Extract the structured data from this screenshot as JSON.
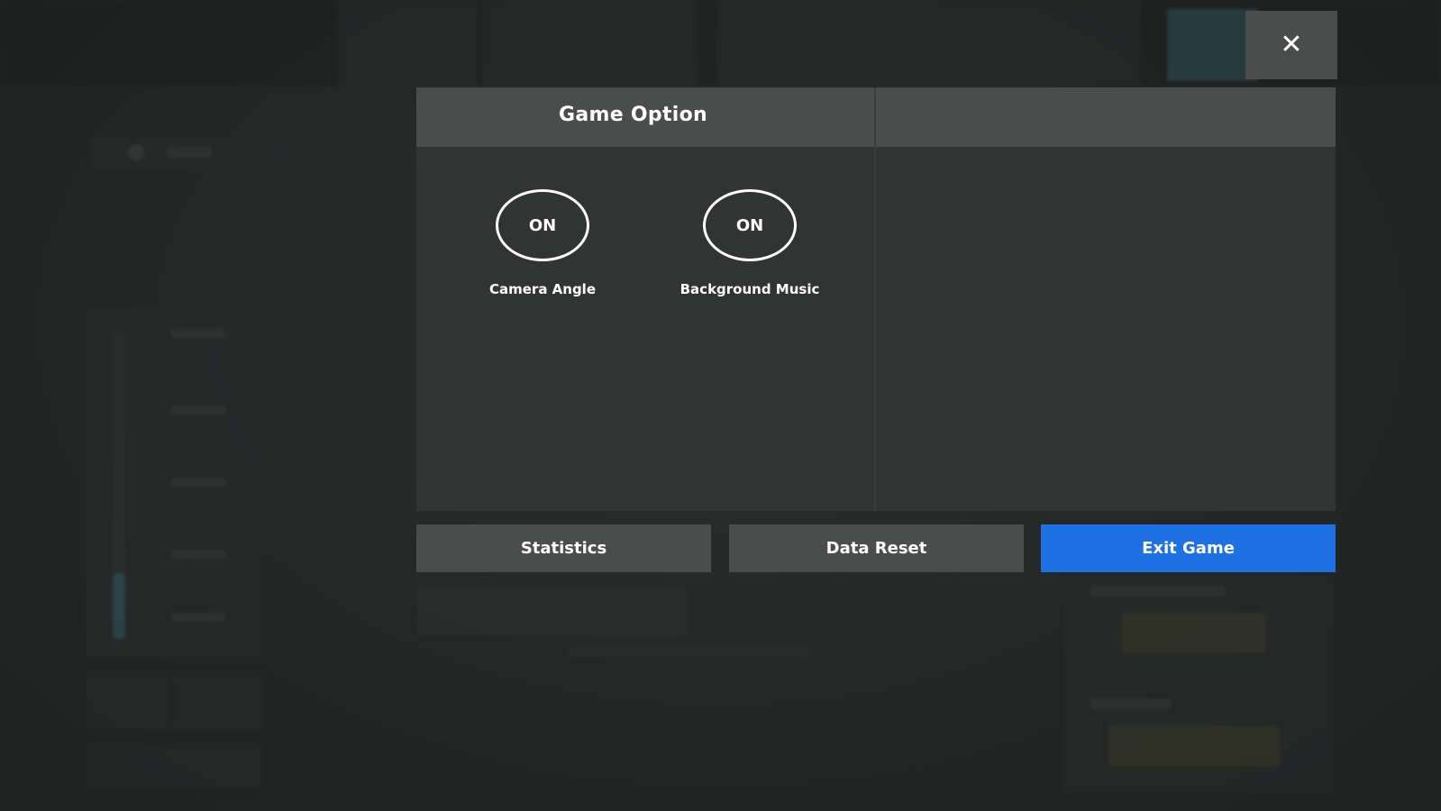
{
  "modal": {
    "title": "Game Option",
    "close_icon": "close-icon",
    "close_glyph": "✕",
    "options": [
      {
        "state": "ON",
        "label": "Camera Angle"
      },
      {
        "state": "ON",
        "label": "Background Music"
      }
    ]
  },
  "footer": {
    "statistics_label": "Statistics",
    "data_reset_label": "Data Reset",
    "exit_game_label": "Exit Game"
  },
  "colors": {
    "primary": "#1f6fe5",
    "panel": "#313433",
    "header": "#4a4d4c"
  }
}
